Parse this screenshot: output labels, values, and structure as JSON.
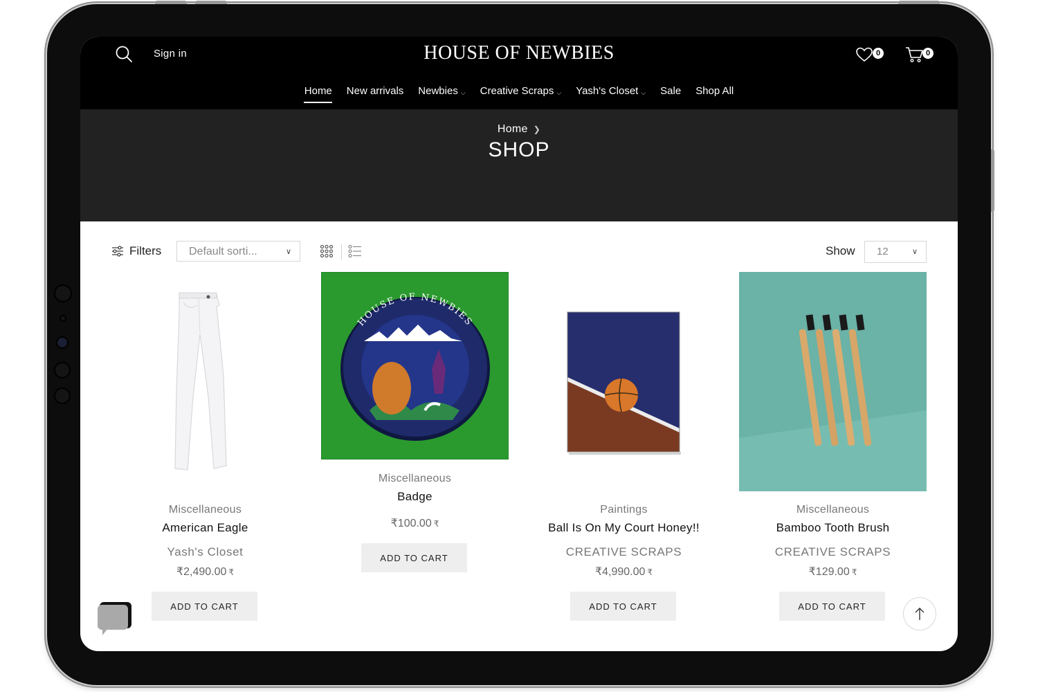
{
  "header": {
    "signin": "Sign in",
    "brand": "HOUSE OF NEWBIES",
    "wishlist_count": "0",
    "cart_count": "0",
    "nav": [
      {
        "label": "Home",
        "dropdown": false,
        "active": true
      },
      {
        "label": "New arrivals",
        "dropdown": false
      },
      {
        "label": "Newbies",
        "dropdown": true
      },
      {
        "label": "Creative Scraps",
        "dropdown": true
      },
      {
        "label": "Yash's Closet",
        "dropdown": true
      },
      {
        "label": "Sale",
        "dropdown": false
      },
      {
        "label": "Shop All",
        "dropdown": false
      }
    ]
  },
  "banner": {
    "breadcrumb": "Home",
    "title": "SHOP"
  },
  "toolbar": {
    "filters": "Filters",
    "sort_value": "Default sorti...",
    "show_label": "Show",
    "show_value": "12"
  },
  "products": [
    {
      "category": "Miscellaneous",
      "name": "American Eagle",
      "brand": "Yash's Closet",
      "price": "₹2,490.00",
      "currency": "₹",
      "button": "ADD TO CART"
    },
    {
      "category": "Miscellaneous",
      "name": "Badge",
      "brand": "",
      "price": "₹100.00",
      "currency": "₹",
      "button": "ADD TO CART"
    },
    {
      "category": "Paintings",
      "name": "Ball Is On My Court Honey!!",
      "brand": "CREATIVE SCRAPS",
      "price": "₹4,990.00",
      "currency": "₹",
      "button": "ADD TO CART"
    },
    {
      "category": "Miscellaneous",
      "name": "Bamboo Tooth Brush",
      "brand": "CREATIVE SCRAPS",
      "price": "₹129.00",
      "currency": "₹",
      "button": "ADD TO CART"
    }
  ],
  "badge_art": {
    "ring_text": "HOUSE OF NEWBIES"
  },
  "colors": {
    "header_bg": "#000000",
    "banner_bg": "#222222",
    "button_bg": "#eeeeee",
    "badge_green": "#2a9a2e",
    "badge_navy": "#1f2a6b",
    "toothbrush_bg": "#6bb2a7"
  }
}
